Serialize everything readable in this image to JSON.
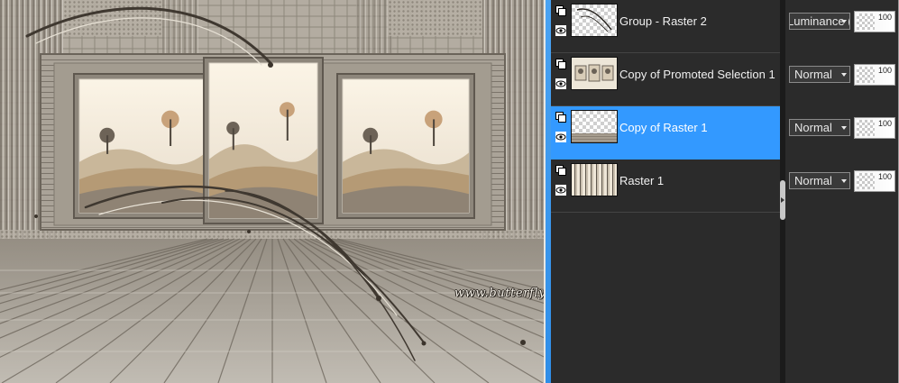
{
  "canvas": {
    "watermark": "www.butterfly.adv.br  -  Maria José"
  },
  "layers_panel": {
    "layers": [
      {
        "name": "Group - Raster 2",
        "blend_mode": "Luminance (",
        "opacity": "100",
        "selected": false,
        "thumb": "brush-stroke"
      },
      {
        "name": "Copy of Promoted Selection 1",
        "blend_mode": "Normal",
        "opacity": "100",
        "selected": false,
        "thumb": "three-frames"
      },
      {
        "name": "Copy of Raster 1",
        "blend_mode": "Normal",
        "opacity": "100",
        "selected": true,
        "thumb": "lace-band"
      },
      {
        "name": "Raster 1",
        "blend_mode": "Normal",
        "opacity": "100",
        "selected": false,
        "thumb": "vertical-stripes"
      }
    ],
    "icons": {
      "layer_type": "raster-layer-icon",
      "visibility": "eye-icon",
      "dropdown": "chevron-down-icon",
      "splitter": "collapse-arrow-icon"
    },
    "colors": {
      "selection": "#3399ff",
      "panel_bg": "#2b2b2b"
    }
  }
}
